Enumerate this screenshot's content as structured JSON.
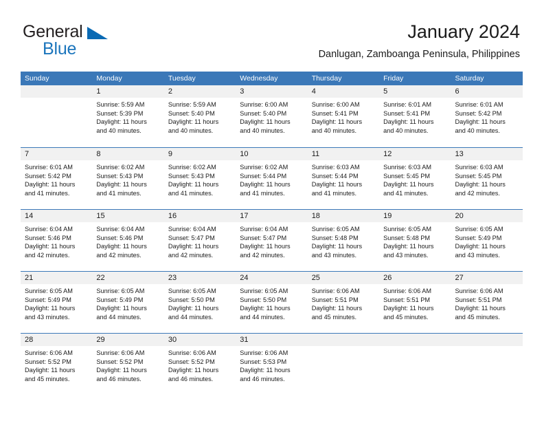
{
  "brand": {
    "name_top": "General",
    "name_bottom": "Blue",
    "accent_color": "#1b75bc",
    "triangle_color": "#0a6ab4"
  },
  "header": {
    "title": "January 2024",
    "subtitle": "Danlugan, Zamboanga Peninsula, Philippines"
  },
  "calendar": {
    "header_bg": "#3b78b8",
    "daynum_bg": "#f1f1f1",
    "weekdays": [
      "Sunday",
      "Monday",
      "Tuesday",
      "Wednesday",
      "Thursday",
      "Friday",
      "Saturday"
    ],
    "weeks": [
      [
        {
          "day": "",
          "sunrise": "",
          "sunset": "",
          "daylight_line1": "",
          "daylight_line2": ""
        },
        {
          "day": "1",
          "sunrise": "Sunrise: 5:59 AM",
          "sunset": "Sunset: 5:39 PM",
          "daylight_line1": "Daylight: 11 hours",
          "daylight_line2": "and 40 minutes."
        },
        {
          "day": "2",
          "sunrise": "Sunrise: 5:59 AM",
          "sunset": "Sunset: 5:40 PM",
          "daylight_line1": "Daylight: 11 hours",
          "daylight_line2": "and 40 minutes."
        },
        {
          "day": "3",
          "sunrise": "Sunrise: 6:00 AM",
          "sunset": "Sunset: 5:40 PM",
          "daylight_line1": "Daylight: 11 hours",
          "daylight_line2": "and 40 minutes."
        },
        {
          "day": "4",
          "sunrise": "Sunrise: 6:00 AM",
          "sunset": "Sunset: 5:41 PM",
          "daylight_line1": "Daylight: 11 hours",
          "daylight_line2": "and 40 minutes."
        },
        {
          "day": "5",
          "sunrise": "Sunrise: 6:01 AM",
          "sunset": "Sunset: 5:41 PM",
          "daylight_line1": "Daylight: 11 hours",
          "daylight_line2": "and 40 minutes."
        },
        {
          "day": "6",
          "sunrise": "Sunrise: 6:01 AM",
          "sunset": "Sunset: 5:42 PM",
          "daylight_line1": "Daylight: 11 hours",
          "daylight_line2": "and 40 minutes."
        }
      ],
      [
        {
          "day": "7",
          "sunrise": "Sunrise: 6:01 AM",
          "sunset": "Sunset: 5:42 PM",
          "daylight_line1": "Daylight: 11 hours",
          "daylight_line2": "and 41 minutes."
        },
        {
          "day": "8",
          "sunrise": "Sunrise: 6:02 AM",
          "sunset": "Sunset: 5:43 PM",
          "daylight_line1": "Daylight: 11 hours",
          "daylight_line2": "and 41 minutes."
        },
        {
          "day": "9",
          "sunrise": "Sunrise: 6:02 AM",
          "sunset": "Sunset: 5:43 PM",
          "daylight_line1": "Daylight: 11 hours",
          "daylight_line2": "and 41 minutes."
        },
        {
          "day": "10",
          "sunrise": "Sunrise: 6:02 AM",
          "sunset": "Sunset: 5:44 PM",
          "daylight_line1": "Daylight: 11 hours",
          "daylight_line2": "and 41 minutes."
        },
        {
          "day": "11",
          "sunrise": "Sunrise: 6:03 AM",
          "sunset": "Sunset: 5:44 PM",
          "daylight_line1": "Daylight: 11 hours",
          "daylight_line2": "and 41 minutes."
        },
        {
          "day": "12",
          "sunrise": "Sunrise: 6:03 AM",
          "sunset": "Sunset: 5:45 PM",
          "daylight_line1": "Daylight: 11 hours",
          "daylight_line2": "and 41 minutes."
        },
        {
          "day": "13",
          "sunrise": "Sunrise: 6:03 AM",
          "sunset": "Sunset: 5:45 PM",
          "daylight_line1": "Daylight: 11 hours",
          "daylight_line2": "and 42 minutes."
        }
      ],
      [
        {
          "day": "14",
          "sunrise": "Sunrise: 6:04 AM",
          "sunset": "Sunset: 5:46 PM",
          "daylight_line1": "Daylight: 11 hours",
          "daylight_line2": "and 42 minutes."
        },
        {
          "day": "15",
          "sunrise": "Sunrise: 6:04 AM",
          "sunset": "Sunset: 5:46 PM",
          "daylight_line1": "Daylight: 11 hours",
          "daylight_line2": "and 42 minutes."
        },
        {
          "day": "16",
          "sunrise": "Sunrise: 6:04 AM",
          "sunset": "Sunset: 5:47 PM",
          "daylight_line1": "Daylight: 11 hours",
          "daylight_line2": "and 42 minutes."
        },
        {
          "day": "17",
          "sunrise": "Sunrise: 6:04 AM",
          "sunset": "Sunset: 5:47 PM",
          "daylight_line1": "Daylight: 11 hours",
          "daylight_line2": "and 42 minutes."
        },
        {
          "day": "18",
          "sunrise": "Sunrise: 6:05 AM",
          "sunset": "Sunset: 5:48 PM",
          "daylight_line1": "Daylight: 11 hours",
          "daylight_line2": "and 43 minutes."
        },
        {
          "day": "19",
          "sunrise": "Sunrise: 6:05 AM",
          "sunset": "Sunset: 5:48 PM",
          "daylight_line1": "Daylight: 11 hours",
          "daylight_line2": "and 43 minutes."
        },
        {
          "day": "20",
          "sunrise": "Sunrise: 6:05 AM",
          "sunset": "Sunset: 5:49 PM",
          "daylight_line1": "Daylight: 11 hours",
          "daylight_line2": "and 43 minutes."
        }
      ],
      [
        {
          "day": "21",
          "sunrise": "Sunrise: 6:05 AM",
          "sunset": "Sunset: 5:49 PM",
          "daylight_line1": "Daylight: 11 hours",
          "daylight_line2": "and 43 minutes."
        },
        {
          "day": "22",
          "sunrise": "Sunrise: 6:05 AM",
          "sunset": "Sunset: 5:49 PM",
          "daylight_line1": "Daylight: 11 hours",
          "daylight_line2": "and 44 minutes."
        },
        {
          "day": "23",
          "sunrise": "Sunrise: 6:05 AM",
          "sunset": "Sunset: 5:50 PM",
          "daylight_line1": "Daylight: 11 hours",
          "daylight_line2": "and 44 minutes."
        },
        {
          "day": "24",
          "sunrise": "Sunrise: 6:05 AM",
          "sunset": "Sunset: 5:50 PM",
          "daylight_line1": "Daylight: 11 hours",
          "daylight_line2": "and 44 minutes."
        },
        {
          "day": "25",
          "sunrise": "Sunrise: 6:06 AM",
          "sunset": "Sunset: 5:51 PM",
          "daylight_line1": "Daylight: 11 hours",
          "daylight_line2": "and 45 minutes."
        },
        {
          "day": "26",
          "sunrise": "Sunrise: 6:06 AM",
          "sunset": "Sunset: 5:51 PM",
          "daylight_line1": "Daylight: 11 hours",
          "daylight_line2": "and 45 minutes."
        },
        {
          "day": "27",
          "sunrise": "Sunrise: 6:06 AM",
          "sunset": "Sunset: 5:51 PM",
          "daylight_line1": "Daylight: 11 hours",
          "daylight_line2": "and 45 minutes."
        }
      ],
      [
        {
          "day": "28",
          "sunrise": "Sunrise: 6:06 AM",
          "sunset": "Sunset: 5:52 PM",
          "daylight_line1": "Daylight: 11 hours",
          "daylight_line2": "and 45 minutes."
        },
        {
          "day": "29",
          "sunrise": "Sunrise: 6:06 AM",
          "sunset": "Sunset: 5:52 PM",
          "daylight_line1": "Daylight: 11 hours",
          "daylight_line2": "and 46 minutes."
        },
        {
          "day": "30",
          "sunrise": "Sunrise: 6:06 AM",
          "sunset": "Sunset: 5:52 PM",
          "daylight_line1": "Daylight: 11 hours",
          "daylight_line2": "and 46 minutes."
        },
        {
          "day": "31",
          "sunrise": "Sunrise: 6:06 AM",
          "sunset": "Sunset: 5:53 PM",
          "daylight_line1": "Daylight: 11 hours",
          "daylight_line2": "and 46 minutes."
        },
        {
          "day": "",
          "sunrise": "",
          "sunset": "",
          "daylight_line1": "",
          "daylight_line2": ""
        },
        {
          "day": "",
          "sunrise": "",
          "sunset": "",
          "daylight_line1": "",
          "daylight_line2": ""
        },
        {
          "day": "",
          "sunrise": "",
          "sunset": "",
          "daylight_line1": "",
          "daylight_line2": ""
        }
      ]
    ]
  }
}
